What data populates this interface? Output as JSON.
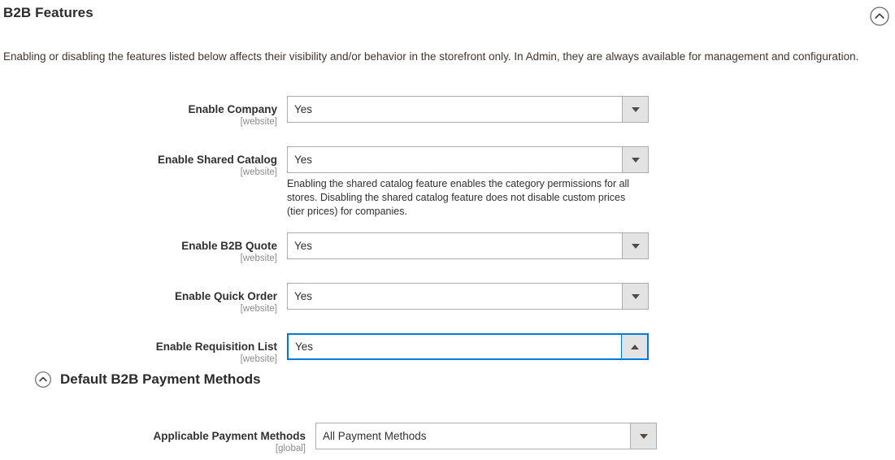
{
  "header": {
    "title": "B2B Features",
    "collapse_icon": "chevron-up-circle-icon",
    "description": "Enabling or disabling the features listed below affects their visibility and/or behavior in the storefront only. In Admin, they are always available for management and configuration."
  },
  "colors": {
    "focus_border": "#007bdb",
    "field_border": "#adadad",
    "button_bg": "#e3e3e3",
    "text": "#303030",
    "scope_text": "#8c8c8c"
  },
  "fields": [
    {
      "label": "Enable Company",
      "scope": "[website]",
      "value": "Yes",
      "arrow": "triangle-down",
      "focused": false,
      "note": ""
    },
    {
      "label": "Enable Shared Catalog",
      "scope": "[website]",
      "value": "Yes",
      "arrow": "triangle-down",
      "focused": false,
      "note": "Enabling the shared catalog feature enables the category permissions for all stores. Disabling the shared catalog feature does not disable custom prices (tier prices) for companies."
    },
    {
      "label": "Enable B2B Quote",
      "scope": "[website]",
      "value": "Yes",
      "arrow": "triangle-down",
      "focused": false,
      "note": ""
    },
    {
      "label": "Enable Quick Order",
      "scope": "[website]",
      "value": "Yes",
      "arrow": "triangle-down",
      "focused": false,
      "note": ""
    },
    {
      "label": "Enable Requisition List",
      "scope": "[website]",
      "value": "Yes",
      "arrow": "triangle-up",
      "focused": true,
      "note": ""
    }
  ],
  "subsection": {
    "icon": "chevron-up-circle-icon",
    "title": "Default B2B Payment Methods",
    "field": {
      "label": "Applicable Payment Methods",
      "scope": "[global]",
      "value": "All Payment Methods",
      "arrow": "triangle-down",
      "focused": false
    }
  }
}
